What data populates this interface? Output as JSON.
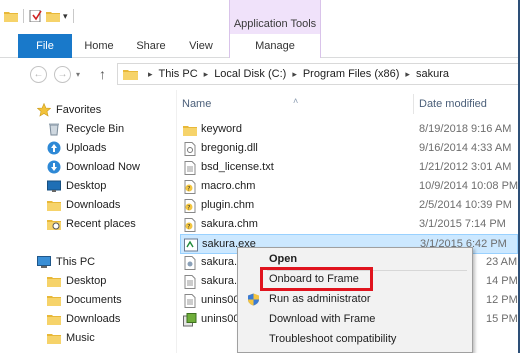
{
  "window": {
    "context_tab_group": "Application Tools"
  },
  "ribbon": {
    "tabs": [
      {
        "label": "File"
      },
      {
        "label": "Home"
      },
      {
        "label": "Share"
      },
      {
        "label": "View"
      },
      {
        "label": "Manage"
      }
    ]
  },
  "address": {
    "crumbs": [
      "This PC",
      "Local Disk (C:)",
      "Program Files (x86)",
      "sakura"
    ]
  },
  "navpane": {
    "favorites_label": "Favorites",
    "favorites": [
      {
        "label": "Recycle Bin",
        "icon": "recycle-bin-icon"
      },
      {
        "label": "Uploads",
        "icon": "upload-icon"
      },
      {
        "label": "Download Now",
        "icon": "download-now-icon"
      },
      {
        "label": "Desktop",
        "icon": "desktop-icon"
      },
      {
        "label": "Downloads",
        "icon": "folder-icon"
      },
      {
        "label": "Recent places",
        "icon": "recent-places-icon"
      }
    ],
    "thispc_label": "This PC",
    "thispc": [
      {
        "label": "Desktop",
        "icon": "folder-icon"
      },
      {
        "label": "Documents",
        "icon": "folder-icon"
      },
      {
        "label": "Downloads",
        "icon": "folder-icon"
      },
      {
        "label": "Music",
        "icon": "folder-icon"
      }
    ]
  },
  "filelist": {
    "columns": {
      "name": "Name",
      "date": "Date modified"
    },
    "rows": [
      {
        "name": "keyword",
        "date": "8/19/2018 9:16 AM",
        "icon": "folder-icon"
      },
      {
        "name": "bregonig.dll",
        "date": "9/16/2014 4:33 AM",
        "icon": "dll-file-icon"
      },
      {
        "name": "bsd_license.txt",
        "date": "1/21/2012 3:01 AM",
        "icon": "text-file-icon"
      },
      {
        "name": "macro.chm",
        "date": "10/9/2014 10:08 PM",
        "icon": "help-file-icon"
      },
      {
        "name": "plugin.chm",
        "date": "2/5/2014 10:39 PM",
        "icon": "help-file-icon"
      },
      {
        "name": "sakura.chm",
        "date": "3/1/2015 7:14 PM",
        "icon": "help-file-icon"
      },
      {
        "name": "sakura.exe",
        "date": "3/1/2015 6:42 PM",
        "icon": "exe-file-icon",
        "selected": true
      },
      {
        "name": "sakura.e",
        "date": "23 AM",
        "icon": "settings-file-icon"
      },
      {
        "name": "sakura.e",
        "date": "14 PM",
        "icon": "text-file-icon"
      },
      {
        "name": "unins00",
        "date": "12 PM",
        "icon": "text-file-icon"
      },
      {
        "name": "unins00",
        "date": "15 PM",
        "icon": "uninstaller-icon"
      }
    ]
  },
  "context_menu": {
    "items": [
      {
        "label": "Open",
        "bold": true
      },
      {
        "label": "Onboard to Frame",
        "highlighted": true
      },
      {
        "label": "Run as administrator",
        "icon": "uac-shield-icon"
      },
      {
        "label": "Download with Frame"
      },
      {
        "label": "Troubleshoot compatibility"
      }
    ]
  },
  "colors": {
    "file_tab": "#1979ca",
    "context_tab": "#f0e2fa",
    "selection": "#cce8ff",
    "highlight_box": "#e0141e"
  }
}
